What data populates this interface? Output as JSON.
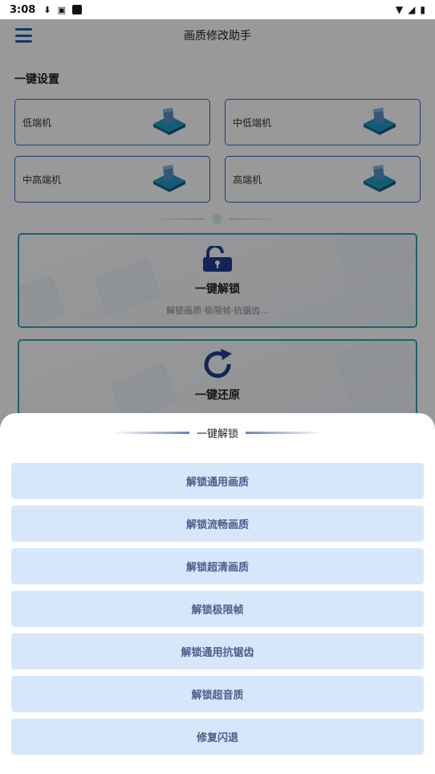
{
  "status_bar": {
    "time": "3:08"
  },
  "app_bar": {
    "title": "画质修改助手",
    "menu_icon": "hamburger-menu-icon"
  },
  "section_title": "一键设置",
  "presets": [
    {
      "label": "低端机",
      "icon": "device-illustration"
    },
    {
      "label": "中低端机",
      "icon": "device-illustration"
    },
    {
      "label": "中高端机",
      "icon": "device-illustration"
    },
    {
      "label": "高端机",
      "icon": "device-illustration"
    }
  ],
  "cards": [
    {
      "title": "一键解锁",
      "subtitle": "解锁画质·极限帧·抗锯齿...",
      "icon": "unlock-icon"
    },
    {
      "title": "一键还原",
      "subtitle": "",
      "icon": "restore-icon"
    }
  ],
  "sheet": {
    "title": "一键解锁",
    "options": [
      "解锁通用画质",
      "解锁流畅画质",
      "解锁超清画质",
      "解锁极限帧",
      "解锁通用抗锯齿",
      "解锁超音质",
      "修复闪退"
    ]
  },
  "colors": {
    "accent": "#2f66c7",
    "teal_border": "#2ea5b8",
    "option_bg": "#d7e7fb",
    "option_text": "#4a5d8c"
  }
}
